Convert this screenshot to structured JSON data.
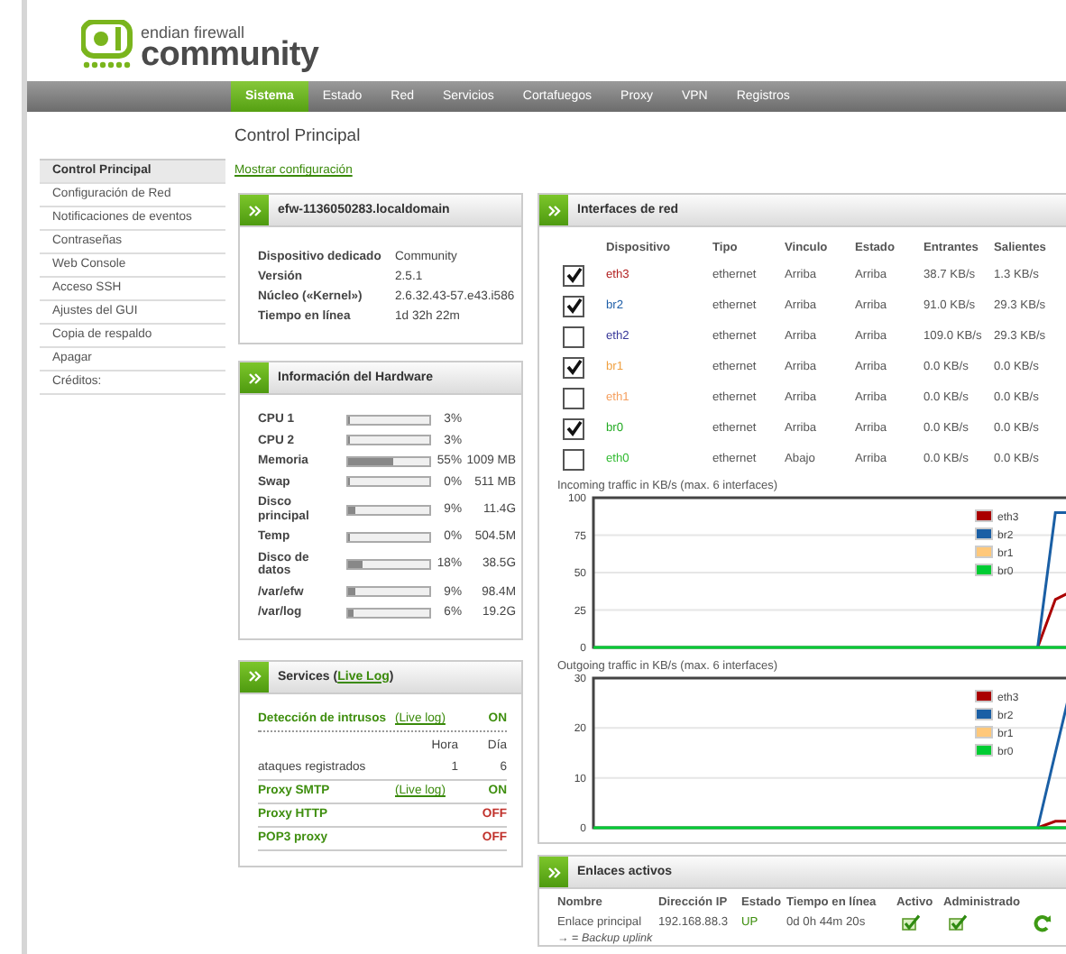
{
  "logo": {
    "line1": "endian firewall",
    "line2": "community"
  },
  "nav": [
    {
      "label": "Sistema",
      "selected": true
    },
    {
      "label": "Estado",
      "selected": false
    },
    {
      "label": "Red",
      "selected": false
    },
    {
      "label": "Servicios",
      "selected": false
    },
    {
      "label": "Cortafuegos",
      "selected": false
    },
    {
      "label": "Proxy",
      "selected": false
    },
    {
      "label": "VPN",
      "selected": false
    },
    {
      "label": "Registros",
      "selected": false
    }
  ],
  "sidebar": [
    {
      "label": "Control Principal",
      "selected": true
    },
    {
      "label": "Configuración de Red",
      "selected": false
    },
    {
      "label": "Notificaciones de eventos",
      "selected": false
    },
    {
      "label": "Contraseñas",
      "selected": false
    },
    {
      "label": "Web Console",
      "selected": false
    },
    {
      "label": "Acceso SSH",
      "selected": false
    },
    {
      "label": "Ajustes del GUI",
      "selected": false
    },
    {
      "label": "Copia de respaldo",
      "selected": false
    },
    {
      "label": "Apagar",
      "selected": false
    },
    {
      "label": "Créditos:",
      "selected": false
    }
  ],
  "page_title": "Control Principal",
  "config_link": "Mostrar configuración",
  "system": {
    "title": "efw-1136050283.localdomain",
    "rows": [
      {
        "label": "Dispositivo dedicado",
        "value": "Community"
      },
      {
        "label": "Versión",
        "value": "2.5.1"
      },
      {
        "label": "Núcleo («Kernel»)",
        "value": "2.6.32.43-57.e43.i586"
      },
      {
        "label": "Tiempo en línea",
        "value": "1d 32h 22m"
      }
    ]
  },
  "hardware": {
    "title": "Información del Hardware",
    "rows": [
      {
        "label": "CPU 1",
        "level": 0.03,
        "percent": "3%"
      },
      {
        "label": "CPU 2",
        "level": 0.03,
        "percent": "3%"
      },
      {
        "label": "Memoria",
        "level": 0.55,
        "percent": "55%",
        "size": "1009 MB"
      },
      {
        "label": "Swap",
        "level": 0,
        "percent": "0%",
        "size": "511 MB"
      },
      {
        "label": "Disco principal",
        "level": 0.09,
        "percent": "9%",
        "size": "11.4G"
      },
      {
        "label": "Temp",
        "level": 0,
        "percent": "0%",
        "size": "504.5M"
      },
      {
        "label": "Disco de datos",
        "level": 0.18,
        "percent": "18%",
        "size": "38.5G"
      },
      {
        "label": "/var/efw",
        "level": 0.09,
        "percent": "9%",
        "size": "98.4M"
      },
      {
        "label": "/var/log",
        "level": 0.06,
        "percent": "6%",
        "size": "19.2G"
      }
    ]
  },
  "services": {
    "title": "Services (",
    "title_link": "Live Log",
    "title_end": ")",
    "rows": [
      {
        "kind": "service",
        "name": "Detección de intrusos",
        "log": "(Live log)",
        "status": "ON",
        "on": true
      },
      {
        "kind": "stats",
        "columns": [
          "Hora",
          "Día"
        ],
        "label": "ataques registrados",
        "values": [
          "1",
          "6"
        ]
      },
      {
        "kind": "service",
        "name": "Proxy SMTP",
        "log": "(Live log)",
        "status": "ON",
        "on": true
      },
      {
        "kind": "service",
        "name": "Proxy HTTP",
        "status": "OFF",
        "on": false
      },
      {
        "kind": "service",
        "name": "POP3 proxy",
        "status": "OFF",
        "on": false
      }
    ]
  },
  "interfaces": {
    "title": "Interfaces de red",
    "columns": [
      "Dispositivo",
      "Tipo",
      "Vinculo",
      "Estado",
      "Entrantes",
      "Salientes"
    ],
    "rows": [
      {
        "checked": true,
        "device": "eth3",
        "color": "#b22222",
        "type": "ethernet",
        "link": "Arriba",
        "state": "Arriba",
        "incoming": "38.7 KB/s",
        "outgoing": "1.3 KB/s"
      },
      {
        "checked": true,
        "device": "br2",
        "color": "#1f5fa8",
        "type": "ethernet",
        "link": "Arriba",
        "state": "Arriba",
        "incoming": "91.0 KB/s",
        "outgoing": "29.3 KB/s"
      },
      {
        "checked": false,
        "device": "eth2",
        "color": "#3a3a9a",
        "type": "ethernet",
        "link": "Arriba",
        "state": "Arriba",
        "incoming": "109.0 KB/s",
        "outgoing": "29.3 KB/s"
      },
      {
        "checked": true,
        "device": "br1",
        "color": "#f0a040",
        "type": "ethernet",
        "link": "Arriba",
        "state": "Arriba",
        "incoming": "0.0 KB/s",
        "outgoing": "0.0 KB/s"
      },
      {
        "checked": false,
        "device": "eth1",
        "color": "#f5a060",
        "type": "ethernet",
        "link": "Arriba",
        "state": "Arriba",
        "incoming": "0.0 KB/s",
        "outgoing": "0.0 KB/s"
      },
      {
        "checked": true,
        "device": "br0",
        "color": "#22aa22",
        "type": "ethernet",
        "link": "Arriba",
        "state": "Arriba",
        "incoming": "0.0 KB/s",
        "outgoing": "0.0 KB/s"
      },
      {
        "checked": false,
        "device": "eth0",
        "color": "#33bb33",
        "type": "ethernet",
        "link": "Abajo",
        "state": "Arriba",
        "incoming": "0.0 KB/s",
        "outgoing": "0.0 KB/s"
      }
    ],
    "incoming": {
      "chart_data": {
        "type": "line",
        "title": "Incoming traffic in KB/s (max. 6 interfaces)",
        "ylim": [
          0,
          100
        ],
        "yticks": [
          0,
          25,
          50,
          75,
          100
        ],
        "grid": true,
        "legend": "upper right",
        "series": [
          {
            "name": "eth3",
            "color": "#aa0000",
            "values": [
              null,
              null,
              null,
              null,
              null,
              null,
              null,
              null,
              null,
              null,
              null,
              null,
              null,
              null,
              null,
              null,
              null,
              null,
              null,
              null,
              null,
              null,
              null,
              null,
              null,
              0,
              32,
              38
            ]
          },
          {
            "name": "br2",
            "color": "#1a5fa5",
            "values": [
              null,
              null,
              null,
              null,
              null,
              null,
              null,
              null,
              null,
              null,
              null,
              null,
              null,
              null,
              null,
              null,
              null,
              null,
              null,
              null,
              null,
              null,
              null,
              null,
              null,
              0,
              90,
              90
            ]
          },
          {
            "name": "br1",
            "color": "#ffc87a",
            "values": [
              null,
              null,
              null,
              null,
              null,
              null,
              null,
              null,
              null,
              null,
              null,
              null,
              null,
              null,
              null,
              null,
              null,
              null,
              null,
              null,
              null,
              null,
              null,
              null,
              null,
              null,
              null,
              null
            ]
          },
          {
            "name": "br0",
            "color": "#00cc33",
            "values": [
              0,
              0,
              0,
              0,
              0,
              0,
              0,
              0,
              0,
              0,
              0,
              0,
              0,
              0,
              0,
              0,
              0,
              0,
              0,
              0,
              0,
              0,
              0,
              0,
              0,
              0,
              0,
              0
            ]
          }
        ]
      }
    },
    "outgoing": {
      "chart_data": {
        "type": "line",
        "title": "Outgoing traffic in KB/s (max. 6 interfaces)",
        "ylim": [
          0,
          30
        ],
        "yticks": [
          0,
          10,
          20,
          30
        ],
        "grid": true,
        "legend": "upper right",
        "series": [
          {
            "name": "eth3",
            "color": "#aa0000",
            "values": [
              null,
              null,
              null,
              null,
              null,
              null,
              null,
              null,
              null,
              null,
              null,
              null,
              null,
              null,
              null,
              null,
              null,
              null,
              null,
              null,
              null,
              null,
              null,
              null,
              null,
              0,
              1.3,
              1.3
            ]
          },
          {
            "name": "br2",
            "color": "#1a5fa5",
            "values": [
              null,
              null,
              null,
              null,
              null,
              null,
              null,
              null,
              null,
              null,
              null,
              null,
              null,
              null,
              null,
              null,
              null,
              null,
              null,
              null,
              null,
              null,
              null,
              null,
              null,
              0,
              15,
              30
            ]
          },
          {
            "name": "br1",
            "color": "#ffc87a",
            "values": [
              null,
              null,
              null,
              null,
              null,
              null,
              null,
              null,
              null,
              null,
              null,
              null,
              null,
              null,
              null,
              null,
              null,
              null,
              null,
              null,
              null,
              null,
              null,
              null,
              null,
              null,
              null,
              null
            ]
          },
          {
            "name": "br0",
            "color": "#00cc33",
            "values": [
              0,
              0,
              0,
              0,
              0,
              0,
              0,
              0,
              0,
              0,
              0,
              0,
              0,
              0,
              0,
              0,
              0,
              0,
              0,
              0,
              0,
              0,
              0,
              0,
              0,
              0,
              0,
              0
            ]
          }
        ]
      }
    }
  },
  "uplinks": {
    "title": "Enlaces activos",
    "columns": [
      "Nombre",
      "Dirección IP",
      "Estado",
      "Tiempo en línea",
      "Activo",
      "Administrado"
    ],
    "rows": [
      {
        "name": "Enlace principal",
        "ip": "192.168.88.3",
        "status": "UP",
        "uptime": "0d 0h 44m 20s",
        "active": true,
        "managed": true
      }
    ],
    "legend": "→ = *Backup uplink*"
  }
}
